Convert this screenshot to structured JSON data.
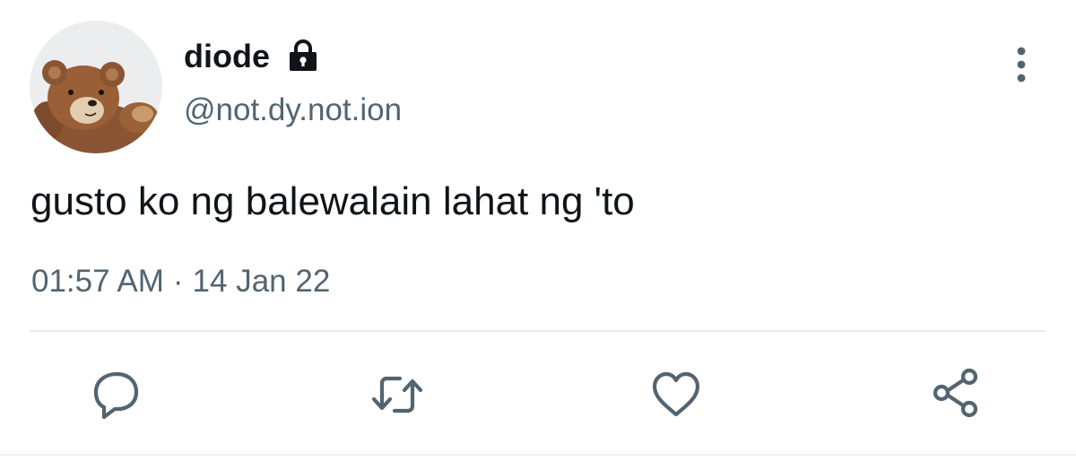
{
  "tweet": {
    "author": {
      "display_name": "diode",
      "handle": "@not.dy.not.ion",
      "avatar_icon": "teddy-bear-avatar",
      "protected_icon": "lock-icon"
    },
    "text": "gusto ko ng balewalain lahat ng 'to",
    "time": "01:57 AM",
    "separator": "·",
    "date": "14 Jan 22"
  },
  "actions": {
    "more_icon": "more-vertical-icon",
    "reply_icon": "reply-icon",
    "retweet_icon": "retweet-icon",
    "like_icon": "heart-icon",
    "share_icon": "share-icon"
  },
  "colors": {
    "text_primary": "#0f1419",
    "text_secondary": "#536471",
    "icon": "#536471",
    "divider": "#e7e9ec",
    "background": "#ffffff"
  }
}
